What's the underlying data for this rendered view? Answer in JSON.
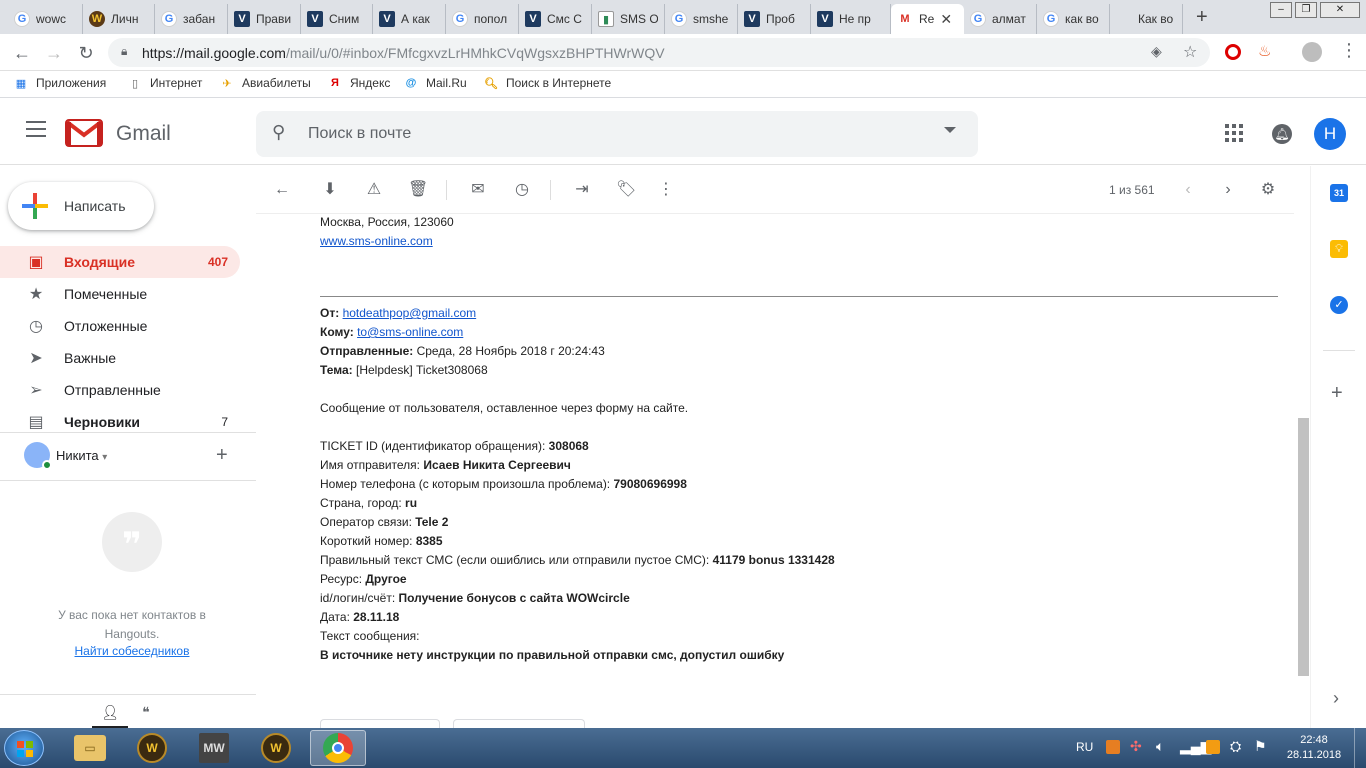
{
  "browser": {
    "tabs": [
      {
        "label": "wowc",
        "favicon": "google-icon"
      },
      {
        "label": "Личн",
        "favicon": "wow-icon"
      },
      {
        "label": "забан",
        "favicon": "google-icon"
      },
      {
        "label": "Прави",
        "favicon": "v-icon"
      },
      {
        "label": "Сним",
        "favicon": "v-icon"
      },
      {
        "label": "А как",
        "favicon": "v-icon"
      },
      {
        "label": "попол",
        "favicon": "google-icon"
      },
      {
        "label": "Смс С",
        "favicon": "v-icon"
      },
      {
        "label": "SMS O",
        "favicon": "sms-icon"
      },
      {
        "label": "smshe",
        "favicon": "google-icon"
      },
      {
        "label": "Проб",
        "favicon": "v-icon"
      },
      {
        "label": "Не пр",
        "favicon": "v-icon"
      },
      {
        "label": "Re",
        "favicon": "gmail-icon",
        "active": true
      },
      {
        "label": "алмат",
        "favicon": "google-icon"
      },
      {
        "label": "как во",
        "favicon": "google-icon"
      },
      {
        "label": "Как во",
        "favicon": "apple-icon"
      }
    ],
    "url_host": "https://mail.google.com",
    "url_path": "/mail/u/0/#inbox/FMfcgxvzLrHMhkCVqWgsxzBHPTHWrWQV",
    "bookmarks": [
      {
        "label": "Приложения",
        "icon": "apps-grid-icon"
      },
      {
        "label": "Интернет",
        "icon": "page-icon"
      },
      {
        "label": "Авиабилеты",
        "icon": "plane-icon"
      },
      {
        "label": "Яндекс",
        "icon": "yandex-icon"
      },
      {
        "label": "Mail.Ru",
        "icon": "mailru-icon"
      },
      {
        "label": "Поиск в Интернете",
        "icon": "search-bookmark-icon"
      }
    ]
  },
  "gmail": {
    "logo_text": "Gmail",
    "search_placeholder": "Поиск в почте",
    "avatar_letter": "Н",
    "compose_label": "Написать",
    "nav": [
      {
        "label": "Входящие",
        "count": "407",
        "icon": "inbox-icon",
        "active": true
      },
      {
        "label": "Помеченные",
        "count": "",
        "icon": "star-icon"
      },
      {
        "label": "Отложенные",
        "count": "",
        "icon": "clock-icon"
      },
      {
        "label": "Важные",
        "count": "",
        "icon": "important-icon"
      },
      {
        "label": "Отправленные",
        "count": "",
        "icon": "send-icon"
      },
      {
        "label": "Черновики",
        "count": "7",
        "icon": "draft-icon",
        "bold": true
      }
    ],
    "hangouts": {
      "user": "Никита",
      "empty_text_1": "У вас пока нет контактов в",
      "empty_text_2": "Hangouts.",
      "find_link": "Найти собеседников"
    },
    "pager": "1 из 561"
  },
  "email": {
    "address_line": "Москва, Россия, 123060",
    "site_link": "www.sms-online.com",
    "from_label": "От:",
    "from_value": "hotdeathpop@gmail.com",
    "to_label": "Кому:",
    "to_value": "to@sms-online.com",
    "sent_label": "Отправленные:",
    "sent_value": "Среда, 28 Ноябрь 2018 г 20:24:43",
    "subject_label": "Тема:",
    "subject_value": "[Helpdesk] Ticket308068",
    "intro": "Сообщение от пользователя, оставленное через форму на сайте.",
    "fields": [
      {
        "label": "TICKET ID (идентификатор обращения): ",
        "value": "308068"
      },
      {
        "label": "Имя отправителя: ",
        "value": "Исаев Никита Сергеевич"
      },
      {
        "label": "Номер телефона (с которым произошла проблема): ",
        "value": "79080696998"
      },
      {
        "label": "Страна, город: ",
        "value": "ru"
      },
      {
        "label": "Оператор связи: ",
        "value": "Tele 2"
      },
      {
        "label": "Короткий номер: ",
        "value": "8385"
      },
      {
        "label": "Правильный текст СМС (если ошиблись или отправили пустое СМС): ",
        "value": "41179 bonus 1331428"
      },
      {
        "label": "Ресурс: ",
        "value": "Другое"
      },
      {
        "label": "id/логин/счёт: ",
        "value": "Получение бонусов с сайта WOWcircle"
      },
      {
        "label": "Дата: ",
        "value": "28.11.18"
      },
      {
        "label": "Текст сообщения:",
        "value": ""
      }
    ],
    "message_text": "В источнике нету инструкции по правильной отправки смс, допустил ошибку"
  },
  "taskbar": {
    "lang": "RU",
    "time": "22:48",
    "date": "28.11.2018"
  },
  "colors": {
    "gmail_red": "#d93025",
    "inbox_active_bg": "#fce8e6",
    "avatar_blue": "#1a73e8",
    "link": "#1155cc"
  }
}
